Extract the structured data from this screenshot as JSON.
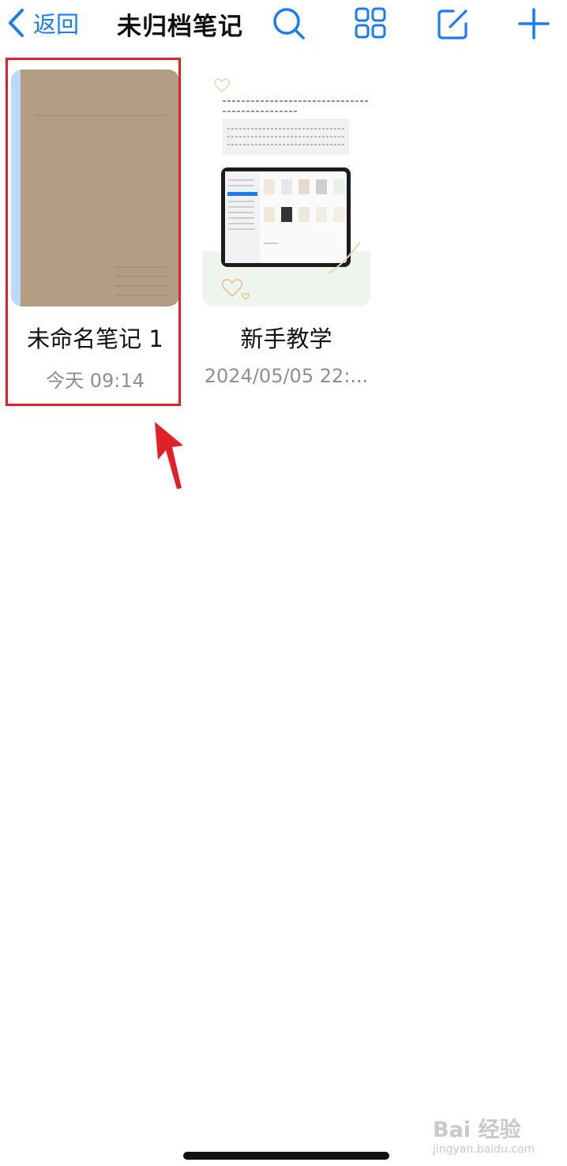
{
  "navbar": {
    "back_label": "返回",
    "title": "未归档笔记"
  },
  "icons": {
    "back": "chevron-left-icon",
    "search": "search-icon",
    "grid": "grid-view-icon",
    "edit": "compose-icon",
    "add": "plus-icon"
  },
  "notes": [
    {
      "title": "未命名笔记 1",
      "date": "今天 09:14"
    },
    {
      "title": "新手教学",
      "date": "2024/05/05 22:..."
    }
  ],
  "watermark": {
    "main": "Bai 经验",
    "sub": "jingyan.baidu.com"
  },
  "colors": {
    "accent": "#1a7cf0",
    "cover_brown": "#b39e84",
    "cover_spine": "#b9dbf5",
    "highlight": "#e0212a",
    "subtext": "#8e8e93"
  }
}
